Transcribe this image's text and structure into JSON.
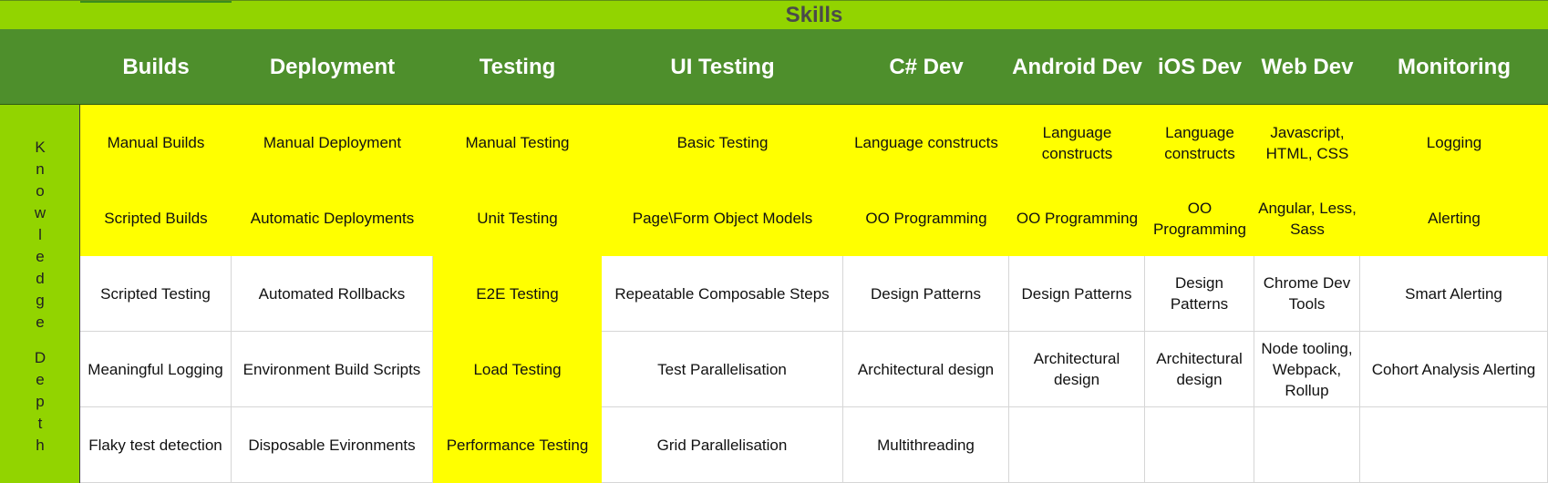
{
  "title": "Skills",
  "side_label_letters": [
    "K",
    "n",
    "o",
    "w",
    "l",
    "e",
    "d",
    "g",
    "e",
    "",
    "D",
    "e",
    "p",
    "t",
    "h"
  ],
  "columns": [
    "Builds",
    "Deployment",
    "Testing",
    "UI Testing",
    "C# Dev",
    "Android Dev",
    "iOS Dev",
    "Web Dev",
    "Monitoring"
  ],
  "rows": [
    [
      "Manual Builds",
      "Manual Deployment",
      "Manual Testing",
      "Basic Testing",
      "Language constructs",
      "Language constructs",
      "Language constructs",
      "Javascript, HTML, CSS",
      "Logging"
    ],
    [
      "Scripted Builds",
      "Automatic Deployments",
      "Unit Testing",
      "Page\\Form Object Models",
      "OO Programming",
      "OO Programming",
      "OO Programming",
      "Angular, Less, Sass",
      "Alerting"
    ],
    [
      "Scripted Testing",
      "Automated Rollbacks",
      "E2E Testing",
      "Repeatable Composable Steps",
      "Design Patterns",
      "Design Patterns",
      "Design Patterns",
      "Chrome Dev Tools",
      "Smart Alerting"
    ],
    [
      "Meaningful Logging",
      "Environment Build Scripts",
      "Load Testing",
      "Test Parallelisation",
      "Architectural design",
      "Architectural design",
      "Architectural design",
      "Node tooling, Webpack, Rollup",
      "Cohort Analysis Alerting"
    ],
    [
      "Flaky test detection",
      "Disposable Evironments",
      "Performance Testing",
      "Grid Parallelisation",
      "Multithreading",
      "",
      "",
      "",
      ""
    ]
  ],
  "highlight": [
    [
      true,
      true,
      true,
      true,
      true,
      true,
      true,
      true,
      true
    ],
    [
      true,
      true,
      true,
      true,
      true,
      true,
      true,
      true,
      true
    ],
    [
      false,
      false,
      true,
      false,
      false,
      false,
      false,
      false,
      false
    ],
    [
      false,
      false,
      true,
      false,
      false,
      false,
      false,
      false,
      false
    ],
    [
      false,
      false,
      true,
      false,
      false,
      false,
      false,
      false,
      false
    ]
  ],
  "colors": {
    "title_band": "#92d400",
    "header": "#4e8f2c",
    "highlight": "#ffff00",
    "plain": "#ffffff"
  }
}
